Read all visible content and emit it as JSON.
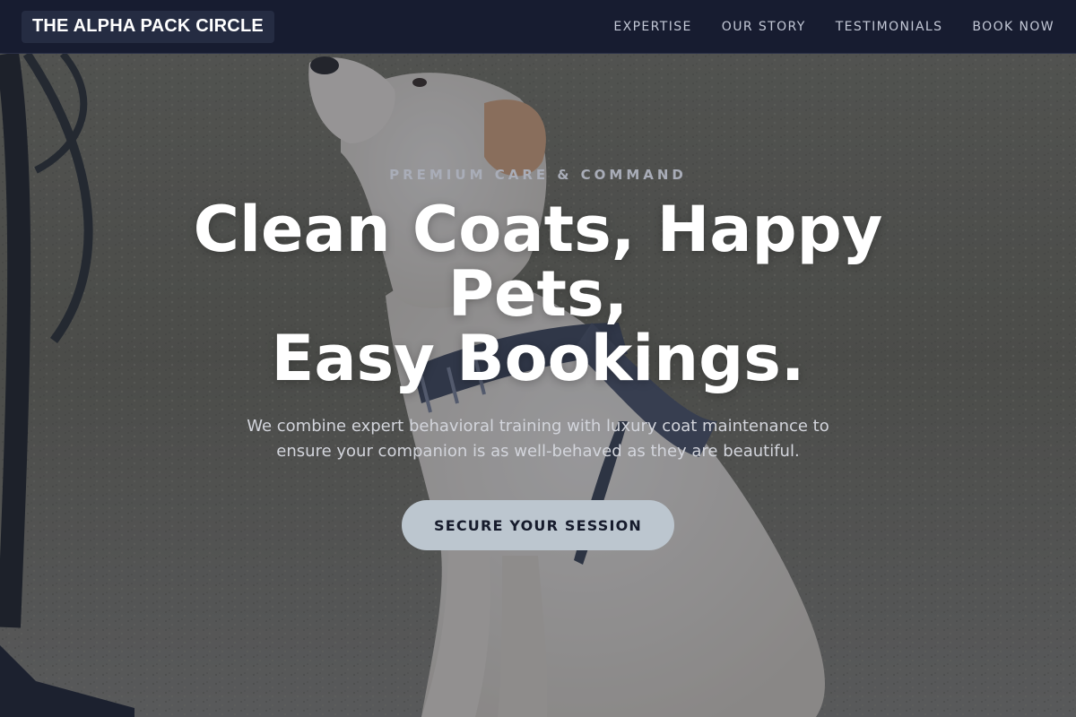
{
  "brand": {
    "name": "THE ALPHA PACK CIRCLE"
  },
  "nav": {
    "items": [
      {
        "label": "EXPERTISE"
      },
      {
        "label": "OUR STORY"
      },
      {
        "label": "TESTIMONIALS"
      },
      {
        "label": "BOOK NOW"
      }
    ]
  },
  "hero": {
    "eyebrow": "PREMIUM CARE & COMMAND",
    "headline_lines": [
      "Clean Coats, Happy",
      "Pets,",
      "Easy Bookings."
    ],
    "subtitle_lines": [
      "We combine expert behavioral training with luxury coat maintenance to",
      "ensure your companion is as well-behaved as they are beautiful."
    ],
    "cta_label": "SECURE YOUR SESSION"
  },
  "colors": {
    "nav_background": "#171c30",
    "brand_badge": "#252c42",
    "cta_background": "#bcc6cf",
    "cta_text": "#161b2c",
    "overlay": "#1a2030"
  }
}
